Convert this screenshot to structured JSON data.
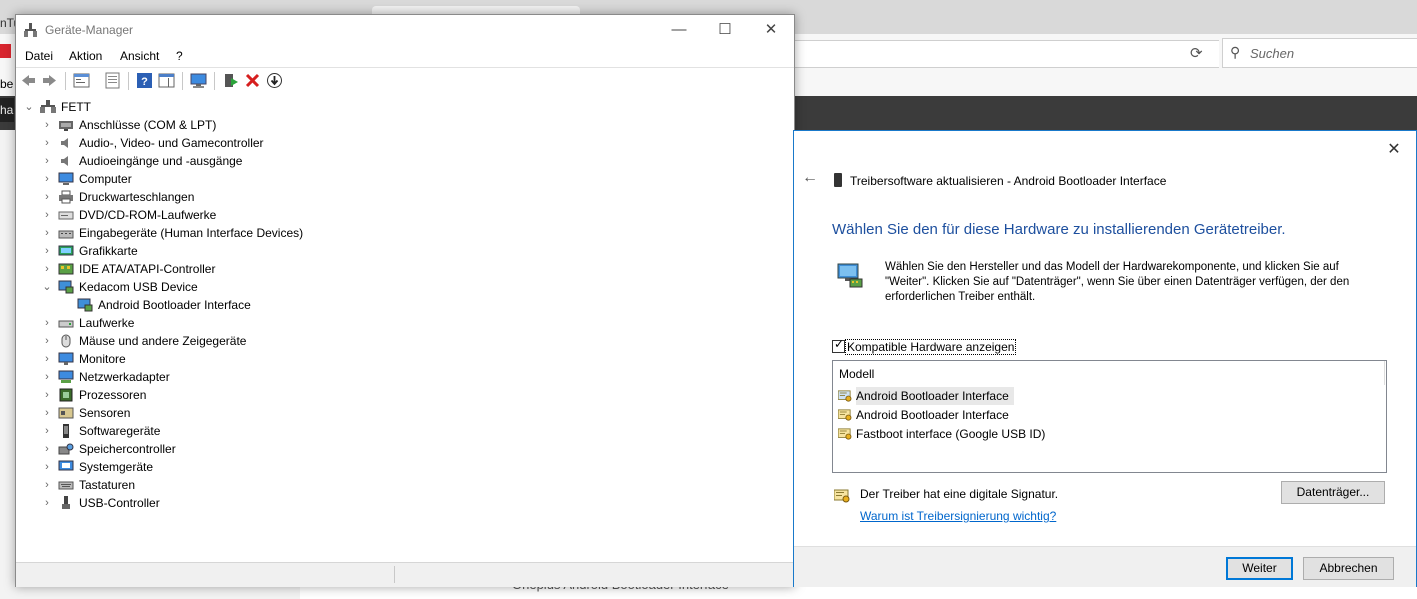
{
  "browser": {
    "tab_left_text": "nTu",
    "search_placeholder": "Suchen",
    "left_cut_text_1": "ha",
    "left_cut_text_2": "be",
    "bottom_text": "Oneplus Android Bootloader Interface"
  },
  "device_manager": {
    "title": "Geräte-Manager",
    "window_buttons": {
      "minimize": "—",
      "maximize": "☐",
      "close": "✕"
    },
    "menu": [
      "Datei",
      "Aktion",
      "Ansicht",
      "?"
    ],
    "root": "FETT",
    "categories": [
      {
        "label": "Anschlüsse (COM & LPT)",
        "icon": "port-icon"
      },
      {
        "label": "Audio-, Video- und Gamecontroller",
        "icon": "speaker-icon"
      },
      {
        "label": "Audioeingänge und -ausgänge",
        "icon": "speaker-icon"
      },
      {
        "label": "Computer",
        "icon": "computer-icon"
      },
      {
        "label": "Druckwarteschlangen",
        "icon": "printer-icon"
      },
      {
        "label": "DVD/CD-ROM-Laufwerke",
        "icon": "dvd-icon"
      },
      {
        "label": "Eingabegeräte (Human Interface Devices)",
        "icon": "hid-icon"
      },
      {
        "label": "Grafikkarte",
        "icon": "display-adapter-icon"
      },
      {
        "label": "IDE ATA/ATAPI-Controller",
        "icon": "ide-icon"
      },
      {
        "label": "Kedacom USB Device",
        "icon": "usb-device-icon",
        "expanded": true,
        "children": [
          "Android Bootloader Interface"
        ]
      },
      {
        "label": "Laufwerke",
        "icon": "drive-icon"
      },
      {
        "label": "Mäuse und andere Zeigegeräte",
        "icon": "mouse-icon"
      },
      {
        "label": "Monitore",
        "icon": "monitor-icon"
      },
      {
        "label": "Netzwerkadapter",
        "icon": "network-icon"
      },
      {
        "label": "Prozessoren",
        "icon": "cpu-icon"
      },
      {
        "label": "Sensoren",
        "icon": "sensor-icon"
      },
      {
        "label": "Softwaregeräte",
        "icon": "software-device-icon"
      },
      {
        "label": "Speichercontroller",
        "icon": "storage-icon"
      },
      {
        "label": "Systemgeräte",
        "icon": "system-icon"
      },
      {
        "label": "Tastaturen",
        "icon": "keyboard-icon"
      },
      {
        "label": "USB-Controller",
        "icon": "usb-icon"
      }
    ]
  },
  "driver_dialog": {
    "header": "Treibersoftware aktualisieren - Android Bootloader Interface",
    "heading": "Wählen Sie den für diese Hardware zu installierenden Gerätetreiber.",
    "description": "Wählen Sie den Hersteller und das Modell der Hardwarekomponente, und klicken Sie auf \"Weiter\". Klicken Sie auf \"Datenträger\", wenn Sie über einen Datenträger verfügen, der den erforderlichen Treiber enthält.",
    "checkbox_label": "Kompatible Hardware anzeigen",
    "checkbox_checked": true,
    "list_header": "Modell",
    "models": [
      "Android Bootloader Interface",
      "Android Bootloader Interface",
      "Fastboot interface (Google USB ID)"
    ],
    "selected_model_index": 0,
    "signature_text": "Der Treiber hat eine digitale Signatur.",
    "signature_link": "Warum ist Treibersignierung wichtig?",
    "disk_button": "Datenträger...",
    "next_button": "Weiter",
    "cancel_button": "Abbrechen",
    "close_glyph": "✕",
    "back_glyph": "←"
  }
}
